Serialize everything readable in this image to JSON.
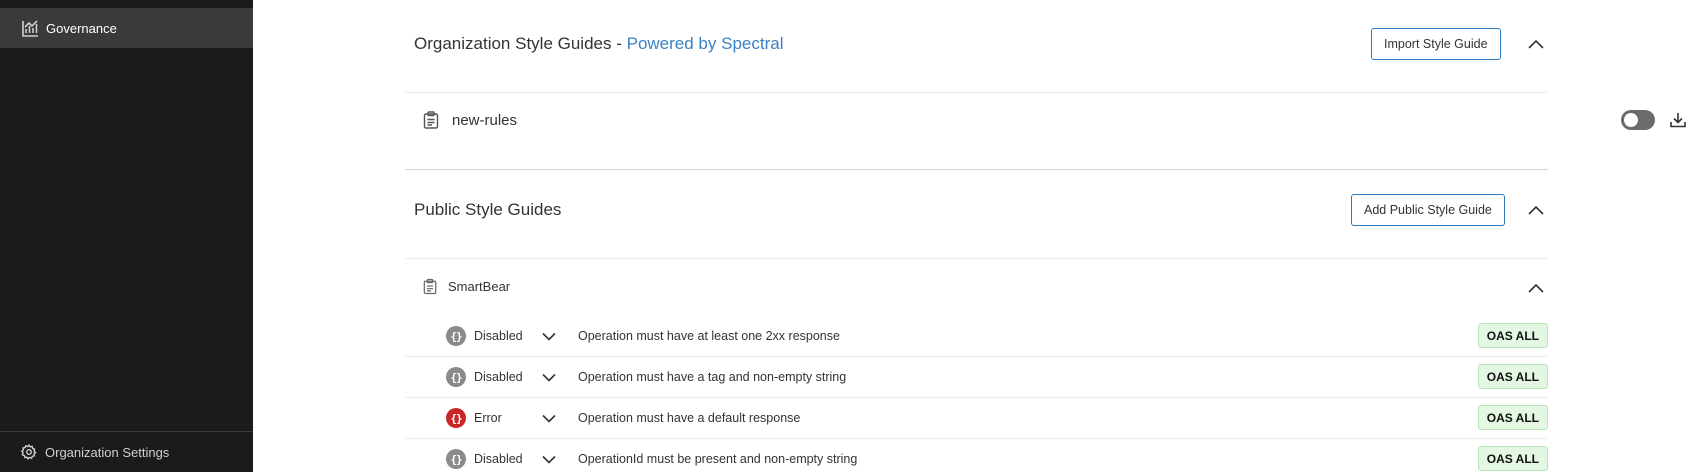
{
  "sidebar": {
    "nav": {
      "label": "Governance",
      "icon": "chart-icon",
      "active": true
    },
    "footer": {
      "label": "Organization Settings",
      "icon": "gear-icon"
    }
  },
  "org": {
    "title": "Organization Style Guides - ",
    "title_accent": "Powered by Spectral",
    "import_label": "Import Style Guide",
    "guides": [
      {
        "name": "new-rules",
        "enabled": false
      }
    ]
  },
  "public": {
    "title": "Public Style Guides",
    "add_label": "Add Public Style Guide",
    "guide_name": "SmartBear",
    "rules": [
      {
        "severity": "Disabled",
        "text": "Operation must have at least one 2xx response",
        "badge": "OAS ALL"
      },
      {
        "severity": "Disabled",
        "text": "Operation must have a tag and non-empty string",
        "badge": "OAS ALL"
      },
      {
        "severity": "Error",
        "text": "Operation must have a default response",
        "badge": "OAS ALL"
      },
      {
        "severity": "Disabled",
        "text": "OperationId must be present and non-empty string",
        "badge": "OAS ALL"
      }
    ]
  },
  "colors": {
    "sidebar_bg": "#1b1b1b",
    "accent": "#3b82c4",
    "error": "#c62828",
    "disabled": "#8a8a8a",
    "badge_bg": "#e3f7e3"
  }
}
